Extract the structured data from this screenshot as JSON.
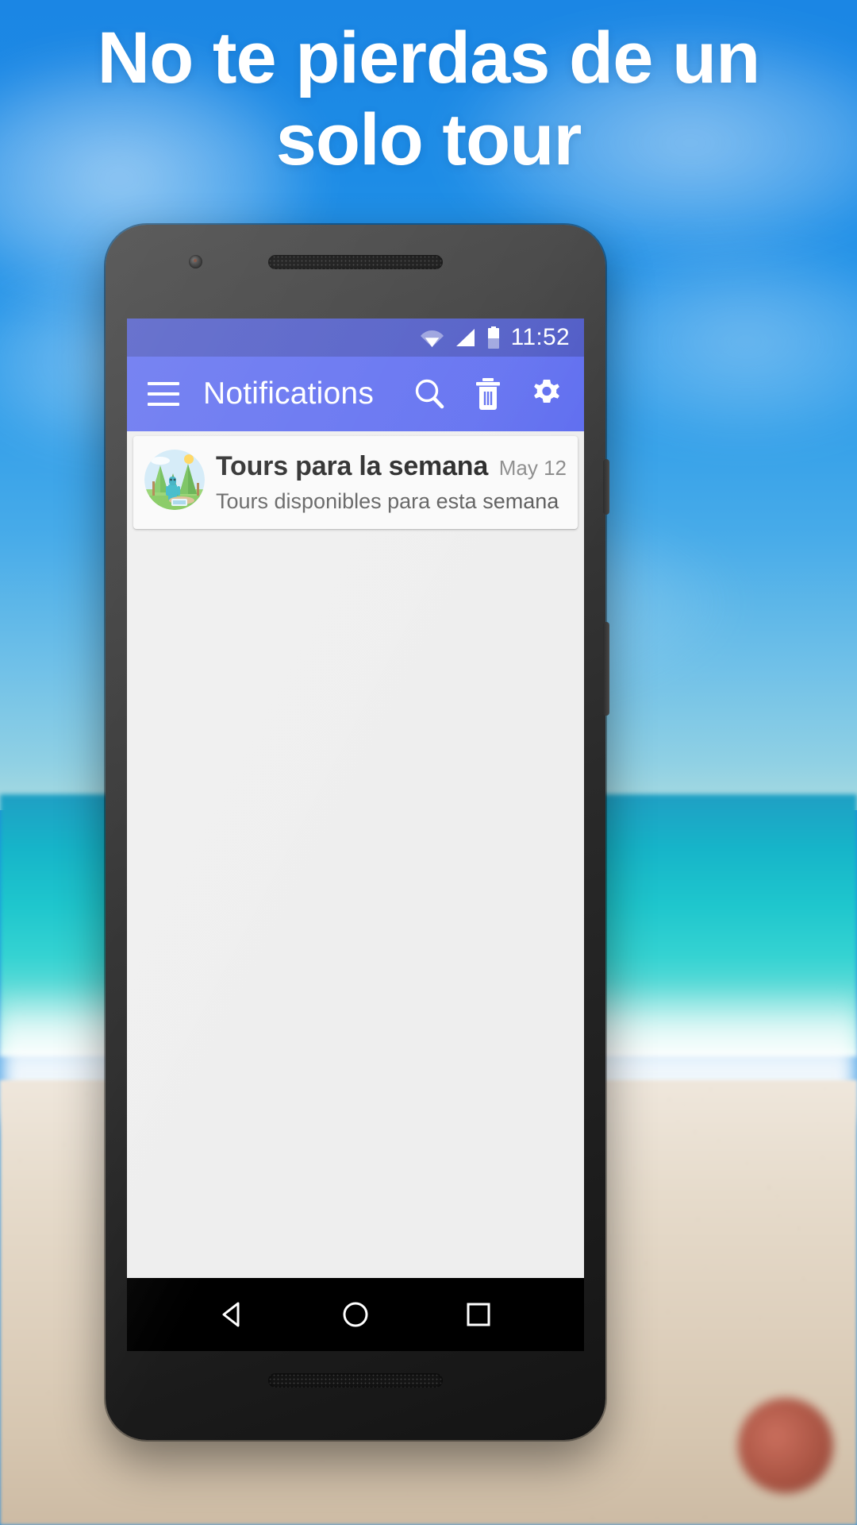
{
  "promo": {
    "headline_line1": "No te pierdas de un",
    "headline_line2": "solo tour",
    "headline_color": "#ffffff",
    "background": "beach-photo-blurred"
  },
  "device": {
    "type": "android-phone",
    "frame_color": "#2a2a2a"
  },
  "statusbar": {
    "time": "11:52",
    "background_color": "#4a56c4",
    "icons": [
      "wifi-icon",
      "cell-signal-icon",
      "battery-icon"
    ],
    "battery_level_percent": 55
  },
  "appbar": {
    "title": "Notifications",
    "background_color": "#5c6bf0",
    "menu_icon": "hamburger-menu-icon",
    "actions": [
      {
        "name": "search",
        "icon": "search-icon"
      },
      {
        "name": "delete",
        "icon": "trash-icon"
      },
      {
        "name": "settings",
        "icon": "gear-icon"
      }
    ]
  },
  "notifications": [
    {
      "title": "Tours para la semana",
      "subtitle": "Tours disponibles para esta semana",
      "date": "May 12",
      "avatar": "forest-camping-avatar"
    }
  ],
  "navbar": {
    "background_color": "#000000",
    "buttons": [
      {
        "name": "back",
        "icon": "back-triangle-icon"
      },
      {
        "name": "home",
        "icon": "home-circle-icon"
      },
      {
        "name": "recents",
        "icon": "recents-square-icon"
      }
    ]
  }
}
